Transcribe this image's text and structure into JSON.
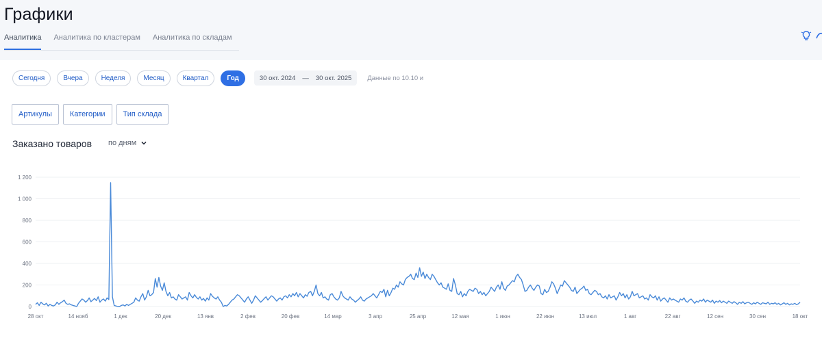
{
  "page": {
    "title": "Графики"
  },
  "tabs": [
    {
      "label": "Аналитика",
      "active": true
    },
    {
      "label": "Аналитика по кластерам",
      "active": false
    },
    {
      "label": "Аналитика по складам",
      "active": false
    }
  ],
  "icons": {
    "bulb": "lightbulb-icon",
    "subscribe": "subscribe-icon"
  },
  "periods": [
    {
      "label": "Сегодня",
      "active": false
    },
    {
      "label": "Вчера",
      "active": false
    },
    {
      "label": "Неделя",
      "active": false
    },
    {
      "label": "Месяц",
      "active": false
    },
    {
      "label": "Квартал",
      "active": false
    },
    {
      "label": "Год",
      "active": true
    }
  ],
  "date_range": {
    "from": "30 окт. 2024",
    "separator": "—",
    "to": "30 окт. 2025"
  },
  "data_note": "Данные по 10.10 и",
  "group_by": [
    "Артикулы",
    "Категории",
    "Тип склада"
  ],
  "chart_header": {
    "title": "Заказано товаров",
    "granularity": "по дням"
  },
  "colors": {
    "accent": "#2f6fe4",
    "line": "#4a8ad8",
    "grid": "#eef0f3"
  },
  "chart_data": {
    "type": "line",
    "title": "Заказано товаров",
    "xlabel": "",
    "ylabel": "",
    "ylim": [
      0,
      1200
    ],
    "yticks": [
      0,
      200,
      400,
      600,
      800,
      1000,
      1200
    ],
    "ytick_labels": [
      "0",
      "200",
      "400",
      "600",
      "800",
      "1 000",
      "1 200"
    ],
    "xtick_labels": [
      "28 окт",
      "14 нояб",
      "1 дек",
      "20 дек",
      "13 янв",
      "2 фев",
      "20 фев",
      "14 мар",
      "3 апр",
      "25 апр",
      "12 мая",
      "1 июн",
      "22 июн",
      "13 июл",
      "1 авг",
      "22 авг",
      "12 сен",
      "30 сен",
      "18 окт"
    ],
    "series": [
      {
        "values": [
          20,
          35,
          10,
          40,
          25,
          15,
          30,
          5,
          20,
          10,
          5,
          15,
          40,
          20,
          35,
          45,
          60,
          30,
          20,
          25,
          15,
          10,
          5,
          0,
          30,
          50,
          70,
          60,
          40,
          55,
          80,
          45,
          60,
          75,
          55,
          90,
          40,
          60,
          70,
          50,
          80,
          65,
          1150,
          90,
          10,
          5,
          0,
          0,
          10,
          15,
          5,
          20,
          10,
          20,
          30,
          40,
          80,
          60,
          50,
          90,
          120,
          60,
          90,
          150,
          100,
          110,
          130,
          260,
          180,
          270,
          190,
          150,
          220,
          140,
          100,
          130,
          80,
          90,
          70,
          60,
          110,
          90,
          70,
          80,
          90,
          60,
          130,
          100,
          80,
          110,
          85,
          70,
          90,
          60,
          75,
          50,
          80,
          60,
          120,
          95,
          80,
          70,
          90,
          60,
          40,
          0,
          10,
          5,
          20,
          40,
          60,
          70,
          90,
          110,
          100,
          80,
          60,
          40,
          70,
          90,
          60,
          30,
          60,
          100,
          80,
          60,
          40,
          55,
          75,
          90,
          60,
          80,
          100,
          90,
          70,
          50,
          70,
          80,
          60,
          90,
          100,
          80,
          110,
          90,
          120,
          100,
          130,
          90,
          120,
          100,
          80,
          110,
          95,
          130,
          140,
          100,
          140,
          200,
          120,
          100,
          130,
          80,
          90,
          70,
          60,
          110,
          120,
          90,
          70,
          60,
          80,
          140,
          100,
          80,
          70,
          60,
          90,
          70,
          60,
          40,
          55,
          70,
          90,
          60,
          50,
          70,
          80,
          90,
          100,
          120,
          100,
          80,
          110,
          140,
          130,
          160,
          90,
          150,
          100,
          130,
          170,
          160,
          200,
          180,
          230,
          210,
          200,
          250,
          270,
          280,
          300,
          260,
          250,
          310,
          270,
          360,
          280,
          320,
          260,
          300,
          270,
          250,
          300,
          280,
          250,
          220,
          200,
          220,
          180,
          170,
          160,
          210,
          150,
          140,
          260,
          200,
          120,
          110,
          140,
          90,
          120,
          100,
          140,
          160,
          150,
          140,
          170,
          160,
          120,
          140,
          110,
          130,
          100,
          120,
          140,
          180,
          160,
          140,
          180,
          200,
          160,
          230,
          170,
          150,
          190,
          200,
          220,
          240,
          230,
          280,
          300,
          270,
          250,
          200,
          140,
          150,
          180,
          200,
          170,
          150,
          180,
          200,
          190,
          120,
          110,
          160,
          130,
          140,
          180,
          230,
          210,
          170,
          120,
          160,
          200,
          190,
          240,
          220,
          200,
          180,
          150,
          140,
          180,
          120,
          140,
          160,
          170,
          190,
          150,
          160,
          120,
          110,
          130,
          150,
          140,
          110,
          120,
          90,
          80,
          100,
          70,
          110,
          80,
          90,
          100,
          60,
          90,
          130,
          100,
          120,
          80,
          110,
          70,
          90,
          140,
          100,
          110,
          120,
          80,
          90,
          100,
          70,
          80,
          60,
          110,
          90,
          80,
          100,
          60,
          90,
          50,
          70,
          80,
          60,
          40,
          80,
          60,
          70,
          60,
          50,
          40,
          70,
          60,
          80,
          50,
          40,
          60,
          70,
          50,
          30,
          50,
          40,
          60,
          50,
          70,
          40,
          60,
          50,
          40,
          60,
          30,
          50,
          40,
          55,
          35,
          50,
          40,
          30,
          50,
          40,
          30,
          45,
          35,
          20,
          40,
          30,
          45,
          25,
          35,
          40,
          30,
          20,
          35,
          25,
          40,
          30,
          20,
          35,
          30,
          25,
          40,
          20,
          30,
          25,
          35,
          20,
          30,
          15,
          25,
          35,
          20,
          30,
          15,
          25,
          20,
          30,
          18,
          25,
          40
        ]
      }
    ],
    "grid": false,
    "legend": "none"
  }
}
